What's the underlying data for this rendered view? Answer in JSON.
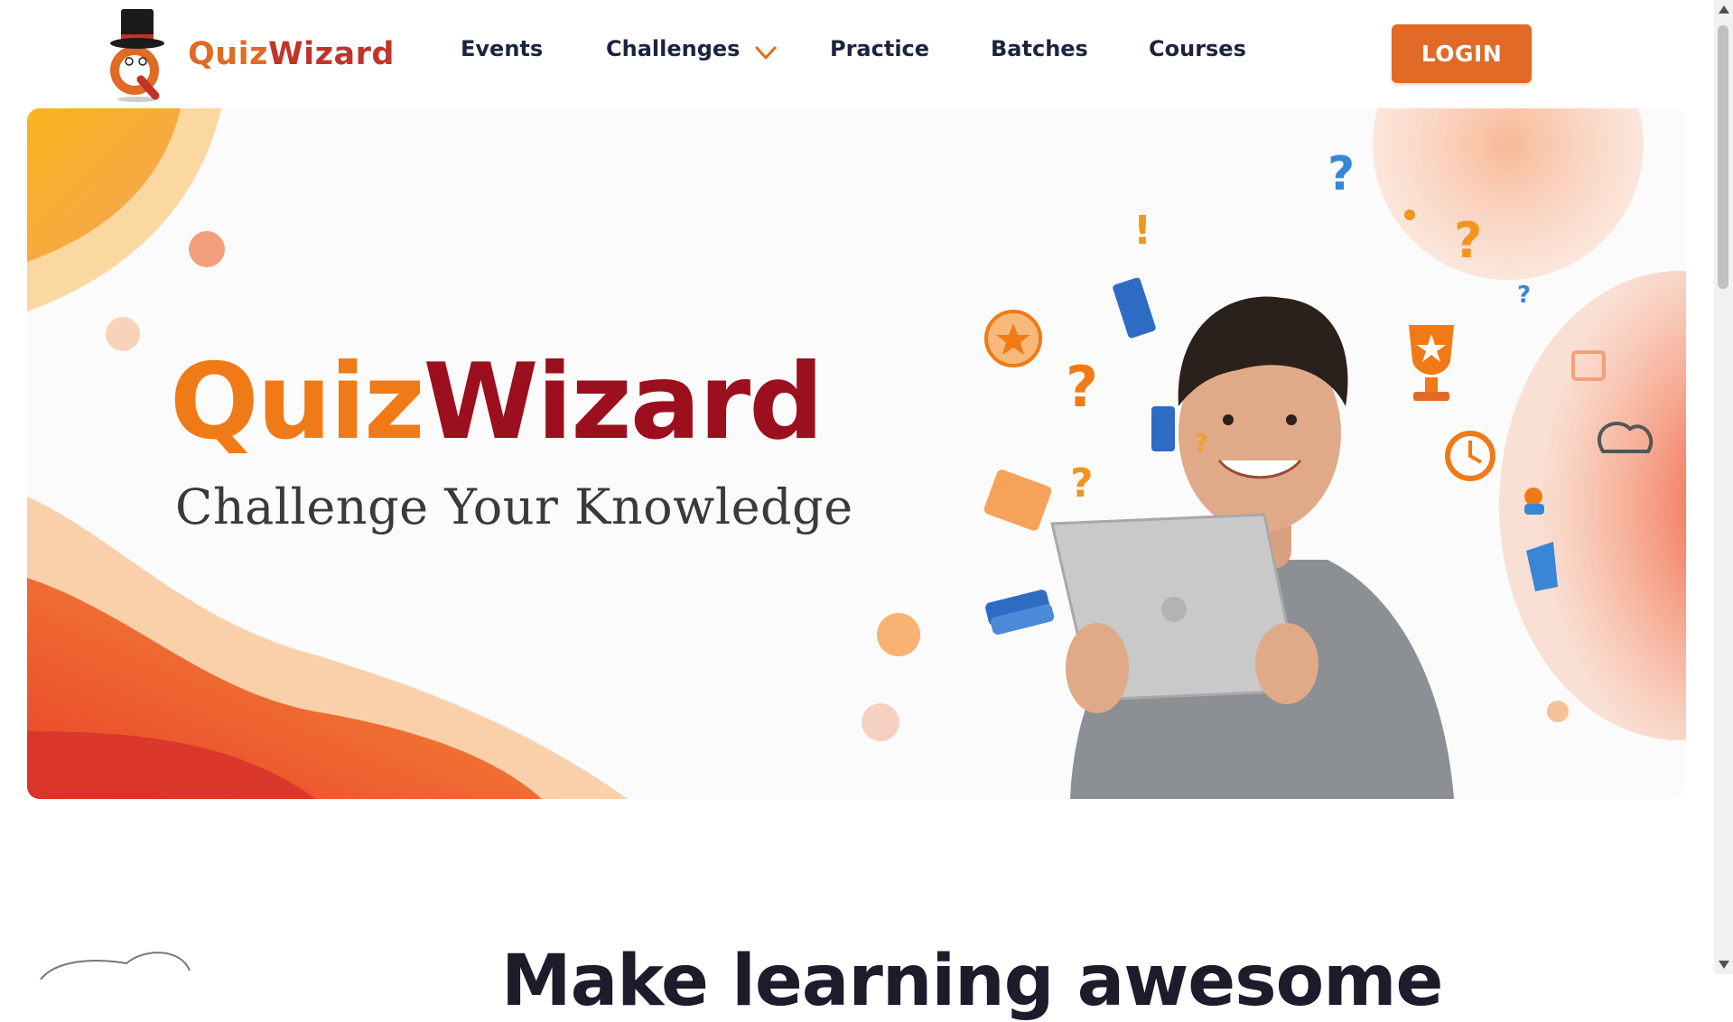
{
  "brand": {
    "name_part1": "Quiz",
    "name_part2": "Wizard"
  },
  "nav": {
    "items": [
      "Events",
      "Challenges",
      "Practice",
      "Batches",
      "Courses"
    ],
    "login_label": "LOGIN"
  },
  "hero": {
    "title_part1": "Quiz",
    "title_part2": "Wizard",
    "tagline": "Challenge Your Knowledge"
  },
  "section": {
    "heading": "Make learning awesome"
  },
  "colors": {
    "accent": "#e06a26",
    "title_orange": "#f07a16",
    "title_red": "#9c0f1e",
    "nav_text": "#1c2340"
  },
  "icons": [
    "top-hat-icon",
    "chevron-down-icon",
    "trophy-icon",
    "question-mark-icon",
    "book-icon",
    "clock-icon",
    "star-icon"
  ]
}
